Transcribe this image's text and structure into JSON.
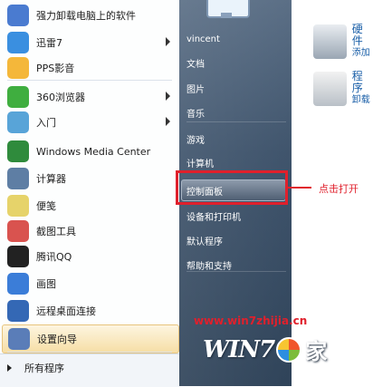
{
  "control_panel_peek": {
    "items": [
      {
        "title": "硬件",
        "subtitle": "添加"
      },
      {
        "title": "程序",
        "subtitle": "卸载"
      }
    ]
  },
  "left_pane": {
    "programs": [
      {
        "label": "强力卸载电脑上的软件",
        "icon": "uninstall-icon",
        "color": "#4a7bd0",
        "arrow": false
      },
      {
        "label": "迅雷7",
        "icon": "thunder-icon",
        "color": "#3a8fe0",
        "arrow": true
      },
      {
        "label": "PPS影音",
        "icon": "pps-icon",
        "color": "#f4b73a",
        "arrow": false
      },
      {
        "label": "360浏览器",
        "icon": "browser-360-icon",
        "color": "#3fae3f",
        "arrow": true
      },
      {
        "label": "入门",
        "icon": "getting-started-icon",
        "color": "#58a4d8",
        "arrow": true
      },
      {
        "label": "Windows Media Center",
        "icon": "media-center-icon",
        "color": "#2f8b3c",
        "arrow": false
      },
      {
        "label": "计算器",
        "icon": "calculator-icon",
        "color": "#5e7ea4",
        "arrow": false
      },
      {
        "label": "便笺",
        "icon": "sticky-notes-icon",
        "color": "#e6d36a",
        "arrow": false
      },
      {
        "label": "截图工具",
        "icon": "snipping-tool-icon",
        "color": "#d9534f",
        "arrow": false
      },
      {
        "label": "腾讯QQ",
        "icon": "qq-icon",
        "color": "#222222",
        "arrow": false
      },
      {
        "label": "画图",
        "icon": "paint-icon",
        "color": "#3b7dd8",
        "arrow": false
      },
      {
        "label": "远程桌面连接",
        "icon": "remote-desktop-icon",
        "color": "#3468b5",
        "arrow": false
      },
      {
        "label": "设置向导",
        "icon": "setup-wizard-icon",
        "color": "#5a7db8",
        "arrow": false,
        "highlighted": true
      }
    ],
    "all_programs": "所有程序"
  },
  "right_pane": {
    "items": [
      {
        "label": "vincent"
      },
      {
        "label": "文档"
      },
      {
        "label": "图片"
      },
      {
        "label": "音乐"
      },
      {
        "label": "游戏"
      },
      {
        "label": "计算机"
      },
      {
        "label": "控制面板",
        "selected": true
      },
      {
        "label": "设备和打印机"
      },
      {
        "label": "默认程序"
      },
      {
        "label": "帮助和支持"
      }
    ]
  },
  "annotation": {
    "callout": "点击打开",
    "color": "#e0202c"
  },
  "watermark": {
    "url": "www.win7zhijia.cn",
    "logo_left": "WIN7",
    "logo_right": "家"
  }
}
